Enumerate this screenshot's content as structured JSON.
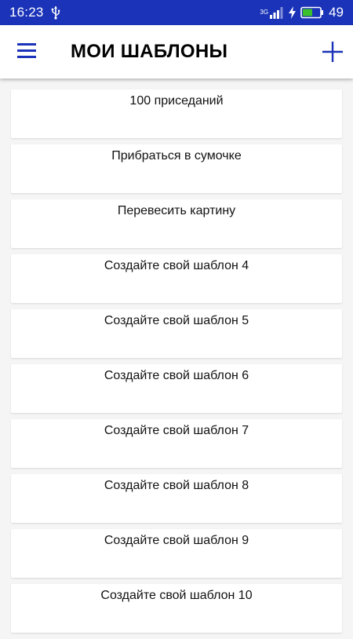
{
  "status_bar": {
    "time": "16:23",
    "network_type": "3G",
    "battery_level": "49",
    "icons": [
      "usb-icon",
      "signal-icon",
      "charging-icon",
      "battery-icon"
    ]
  },
  "app_bar": {
    "title": "МОИ ШАБЛОНЫ",
    "menu_icon": "menu-icon",
    "add_icon": "plus-icon"
  },
  "colors": {
    "status_bar": "#1a33b8",
    "accent": "#1a33b8",
    "battery_fill": "#3bbf2a",
    "background": "#f5f5f5",
    "card": "#ffffff"
  },
  "templates": [
    "100 приседаний",
    "Прибраться в сумочке",
    "Перевесить картину",
    "Создайте свой шаблон 4",
    "Создайте свой шаблон 5",
    "Создайте свой шаблон 6",
    "Создайте свой шаблон 7",
    "Создайте свой шаблон 8",
    "Создайте свой шаблон 9",
    "Создайте свой шаблон 10"
  ]
}
